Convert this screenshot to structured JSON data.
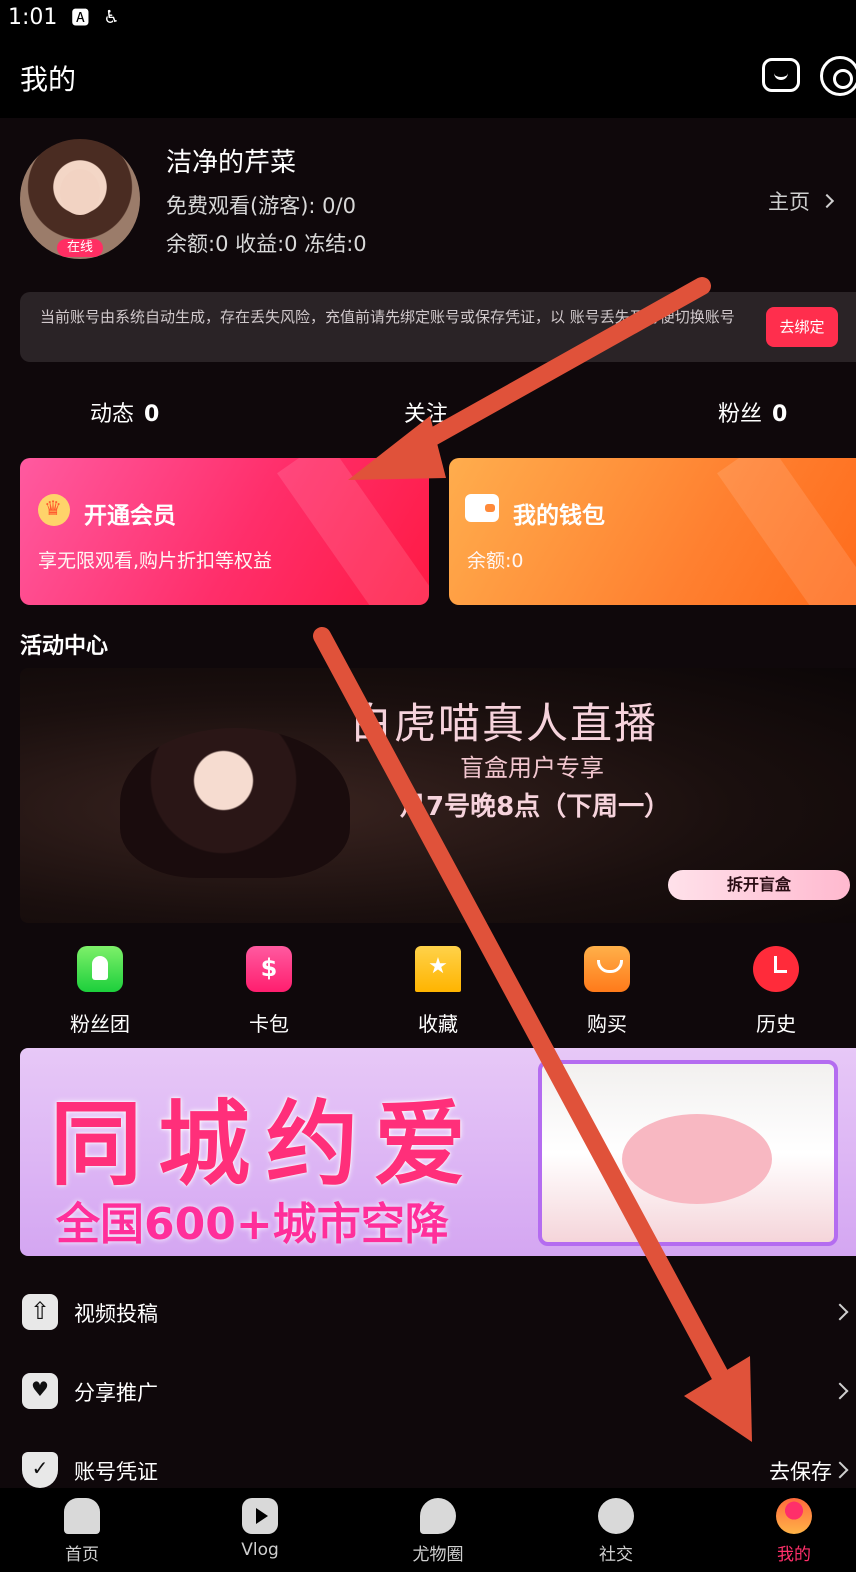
{
  "status_bar": {
    "time": "1:01"
  },
  "header": {
    "title": "我的"
  },
  "profile": {
    "username": "洁净的芹菜",
    "online_badge": "在线",
    "free_watch": "免费观看(游客): 0/0",
    "balances": "余额:0 收益:0 冻结:0",
    "homepage_link": "主页"
  },
  "notice": {
    "text": "当前账号由系统自动生成，存在丢失风险，充值前请先绑定账号或保存凭证，以 账号丢失及方便切换账号",
    "bind_button": "去绑定"
  },
  "stats": [
    {
      "label": "动态",
      "value": "0"
    },
    {
      "label": "关注",
      "value": ""
    },
    {
      "label": "粉丝",
      "value": "0"
    }
  ],
  "cards": {
    "vip": {
      "title": "开通会员",
      "subtitle": "享无限观看,购片折扣等权益"
    },
    "wallet": {
      "title": "我的钱包",
      "subtitle": "余额:0"
    }
  },
  "activity": {
    "section_title": "活动中心",
    "banner_title": "白虎喵真人直播",
    "banner_sub": "盲盒用户专享",
    "banner_date": "月7号晚8点（下周一）",
    "banner_button": "拆开盲盒"
  },
  "quick_links": [
    {
      "label": "粉丝团",
      "icon": "fans-icon"
    },
    {
      "label": "卡包",
      "icon": "card-icon"
    },
    {
      "label": "收藏",
      "icon": "favorite-icon"
    },
    {
      "label": "购买",
      "icon": "shopping-bag-icon"
    },
    {
      "label": "历史",
      "icon": "history-icon"
    }
  ],
  "promo": {
    "title": "同城约爱",
    "subtitle": "全国600+城市空降"
  },
  "menu": [
    {
      "label": "视频投稿",
      "right": ""
    },
    {
      "label": "分享推广",
      "right": ""
    },
    {
      "label": "账号凭证",
      "right": "去保存"
    }
  ],
  "bottom_nav": [
    {
      "label": "首页"
    },
    {
      "label": "Vlog"
    },
    {
      "label": "尤物圈"
    },
    {
      "label": "社交"
    },
    {
      "label": "我的"
    }
  ],
  "colors": {
    "accent": "#ff2f6a",
    "arrow": "#e0523a"
  }
}
